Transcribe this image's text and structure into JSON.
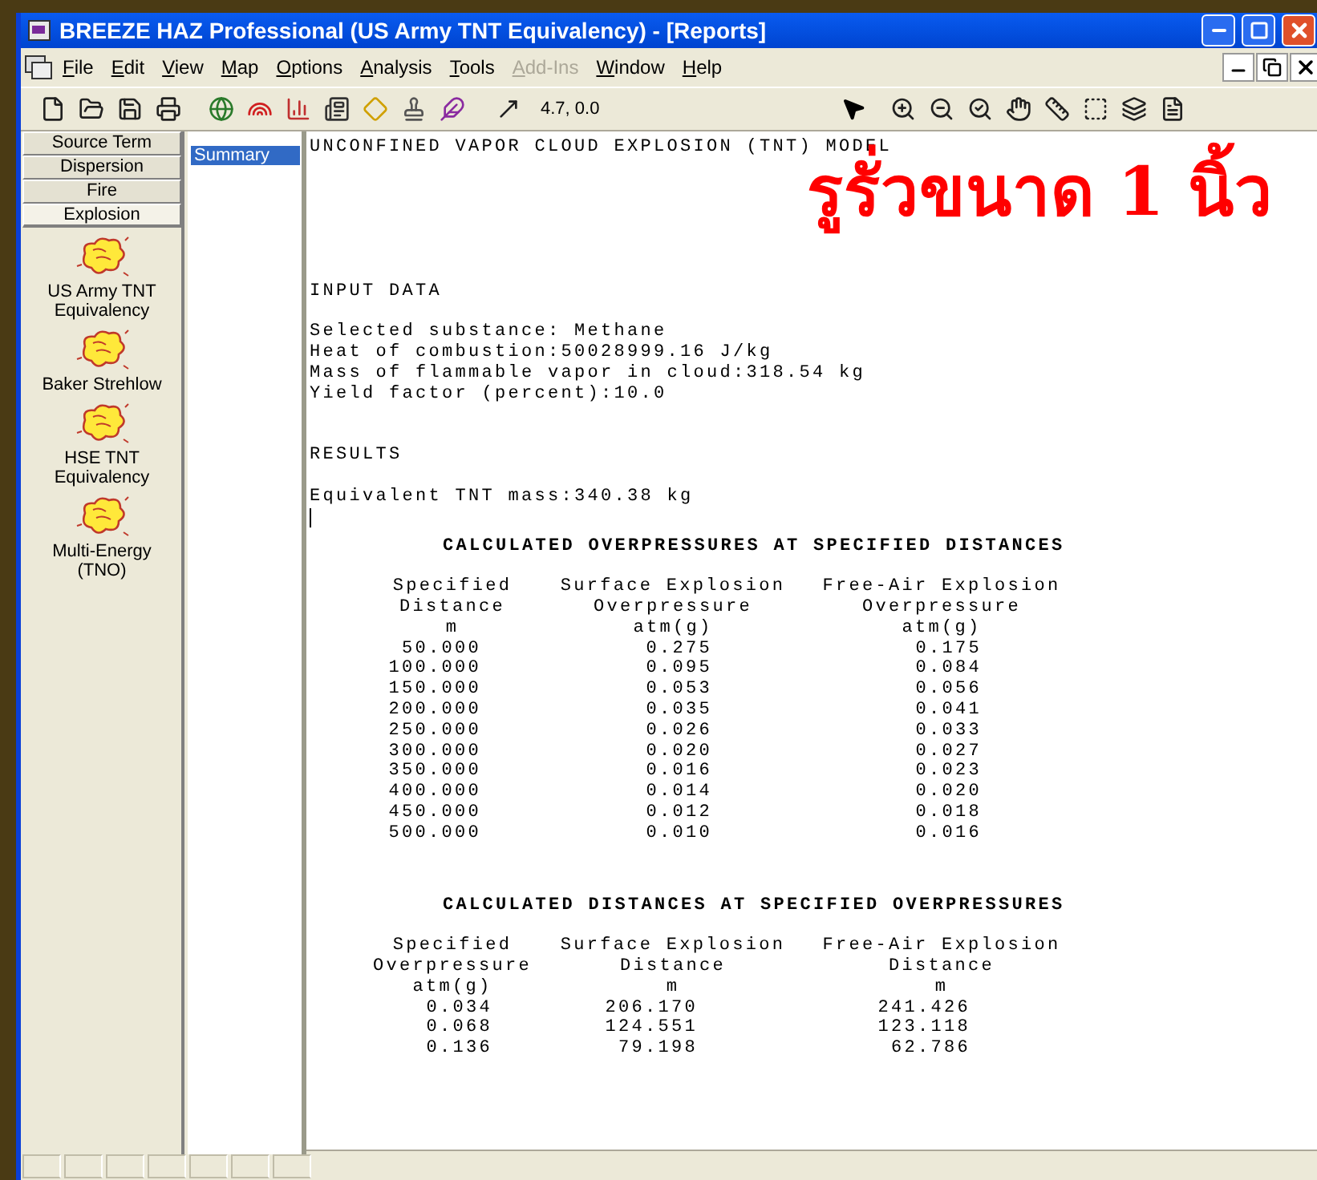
{
  "window": {
    "title": "BREEZE HAZ Professional (US Army TNT Equivalency) - [Reports]"
  },
  "menu": [
    {
      "label": "File",
      "disabled": false
    },
    {
      "label": "Edit",
      "disabled": false
    },
    {
      "label": "View",
      "disabled": false
    },
    {
      "label": "Map",
      "disabled": false
    },
    {
      "label": "Options",
      "disabled": false
    },
    {
      "label": "Analysis",
      "disabled": false
    },
    {
      "label": "Tools",
      "disabled": false
    },
    {
      "label": "Add-Ins",
      "disabled": true
    },
    {
      "label": "Window",
      "disabled": false
    },
    {
      "label": "Help",
      "disabled": false
    }
  ],
  "toolbar": {
    "coordinates": "4.7, 0.0"
  },
  "category_tabs": [
    {
      "label": "Source Term",
      "selected": false
    },
    {
      "label": "Dispersion",
      "selected": false
    },
    {
      "label": "Fire",
      "selected": false
    },
    {
      "label": "Explosion",
      "selected": true
    }
  ],
  "models": [
    {
      "label": "US Army TNT Equivalency"
    },
    {
      "label": "Baker Strehlow"
    },
    {
      "label": "HSE TNT Equivalency"
    },
    {
      "label": "Multi-Energy (TNO)"
    }
  ],
  "reports": [
    {
      "label": "Summary",
      "selected": true
    }
  ],
  "report": {
    "heading": "UNCONFINED VAPOR CLOUD EXPLOSION (TNT) MODEL",
    "input_heading": "INPUT DATA",
    "input_lines": [
      "Selected substance: Methane",
      "Heat of combustion:50028999.16 J/kg",
      "Mass of flammable vapor in cloud:318.54 kg",
      "Yield factor (percent):10.0"
    ],
    "results_heading": "RESULTS",
    "result_lines": [
      "Equivalent TNT mass:340.38 kg"
    ],
    "tables": [
      {
        "title": "CALCULATED OVERPRESSURES AT SPECIFIED DISTANCES",
        "header_rows": [
          [
            "Specified",
            "Surface Explosion",
            "Free-Air Explosion"
          ],
          [
            "Distance",
            "Overpressure",
            "Overpressure"
          ],
          [
            "m",
            "atm(g)",
            "atm(g)"
          ]
        ],
        "rows": [
          [
            "50.000",
            "0.275",
            "0.175"
          ],
          [
            "100.000",
            "0.095",
            "0.084"
          ],
          [
            "150.000",
            "0.053",
            "0.056"
          ],
          [
            "200.000",
            "0.035",
            "0.041"
          ],
          [
            "250.000",
            "0.026",
            "0.033"
          ],
          [
            "300.000",
            "0.020",
            "0.027"
          ],
          [
            "350.000",
            "0.016",
            "0.023"
          ],
          [
            "400.000",
            "0.014",
            "0.020"
          ],
          [
            "450.000",
            "0.012",
            "0.018"
          ],
          [
            "500.000",
            "0.010",
            "0.016"
          ]
        ]
      },
      {
        "title": "CALCULATED DISTANCES AT SPECIFIED OVERPRESSURES",
        "header_rows": [
          [
            "Specified",
            "Surface Explosion",
            "Free-Air Explosion"
          ],
          [
            "Overpressure",
            "Distance",
            "Distance"
          ],
          [
            "atm(g)",
            "m",
            "m"
          ]
        ],
        "rows": [
          [
            "0.034",
            "206.170",
            "241.426"
          ],
          [
            "0.068",
            "124.551",
            "123.118"
          ],
          [
            "0.136",
            "79.198",
            "62.786"
          ]
        ]
      }
    ]
  },
  "annotation": {
    "text": "รูรั่วขนาด 1 นิ้ว"
  }
}
